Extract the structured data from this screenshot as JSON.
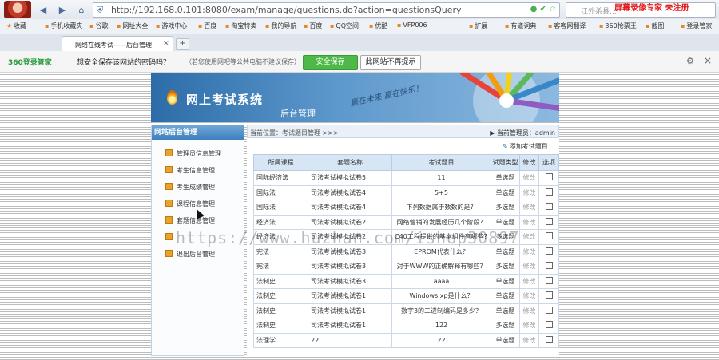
{
  "browser": {
    "url": "http://192.168.0.101:8080/exam/manage/questions.do?action=questionsQuery",
    "search_placeholder": "江外杀县...",
    "recorder_label": "屏幕录像专家 未注册",
    "favorites": [
      "收藏",
      "手机收藏夹",
      "谷歌",
      "网址大全",
      "游戏中心",
      "百度",
      "淘宝特卖",
      "我的导航",
      "百度",
      "QQ空间",
      "优酷",
      "VFP006"
    ],
    "right_favorites": [
      "扩展",
      "有道词典",
      "客客网翻译",
      "360抢票王",
      "截图",
      "登录管家"
    ],
    "tab_title": "网络在线考试——后台管理",
    "tab_close": "×",
    "new_tab": "+"
  },
  "password_bar": {
    "logo": "360登录管家",
    "question": "想安全保存该网站的密码吗？",
    "note": "（若您使用网吧等公共电脑不建议保存）",
    "save_label": "安全保存",
    "never_label": "此网站不再提示"
  },
  "banner": {
    "title": "网上考试系统",
    "subtitle": "后台管理",
    "slogan": "赢在未来 赢在快乐！"
  },
  "sidebar": {
    "header": "网站后台管理",
    "items": [
      "管理员信息管理",
      "考生信息管理",
      "考生成绩管理",
      "课程信息管理",
      "套题信息管理",
      "",
      "退出后台管理"
    ]
  },
  "main": {
    "breadcrumb": "当前位置：考试题目管理 >>>",
    "current_admin": "当前管理员：admin",
    "add_link": "添加考试题目",
    "columns": [
      "所属课程",
      "套题名称",
      "考试题目",
      "试题类型",
      "修改",
      "选项"
    ],
    "rows": [
      {
        "course": "国际经济法",
        "set": "司法考试模拟试卷5",
        "question": "11",
        "type": "单选题",
        "edit": "修改"
      },
      {
        "course": "国际法",
        "set": "司法考试模拟试卷4",
        "question": "5+5",
        "type": "单选题",
        "edit": "修改"
      },
      {
        "course": "国际法",
        "set": "司法考试模拟试卷4",
        "question": "下列数据属于数数的是？",
        "type": "多选题",
        "edit": "修改"
      },
      {
        "course": "经济法",
        "set": "司法考试模拟试卷2",
        "question": "网络营销的发展经历几个阶段？",
        "type": "单选题",
        "edit": "修改"
      },
      {
        "course": "经济法",
        "set": "司法考试模拟试卷2",
        "question": "C40工程提供的基本组件有哪些？",
        "type": "多选题",
        "edit": "修改"
      },
      {
        "course": "宪法",
        "set": "司法考试模拟试卷3",
        "question": "EPROM代表什么？",
        "type": "单选题",
        "edit": "修改"
      },
      {
        "course": "宪法",
        "set": "司法考试模拟试卷3",
        "question": "对于WWW的正确解释有哪些？",
        "type": "多选题",
        "edit": "修改"
      },
      {
        "course": "法制史",
        "set": "司法考试模拟试卷3",
        "question": "aaaa",
        "type": "单选题",
        "edit": "修改"
      },
      {
        "course": "法制史",
        "set": "司法考试模拟试卷1",
        "question": "Windows xp是什么？",
        "type": "单选题",
        "edit": "修改"
      },
      {
        "course": "法制史",
        "set": "司法考试模拟试卷1",
        "question": "数字3的二进制编码是多少？",
        "type": "单选题",
        "edit": "修改"
      },
      {
        "course": "法制史",
        "set": "司法考试模拟试卷1",
        "question": "122",
        "type": "多选题",
        "edit": "修改"
      },
      {
        "course": "法理学",
        "set": "22",
        "question": "22",
        "type": "单选题",
        "edit": "修改"
      }
    ]
  },
  "watermark": "https://www.huzhan.com/ishop30897"
}
